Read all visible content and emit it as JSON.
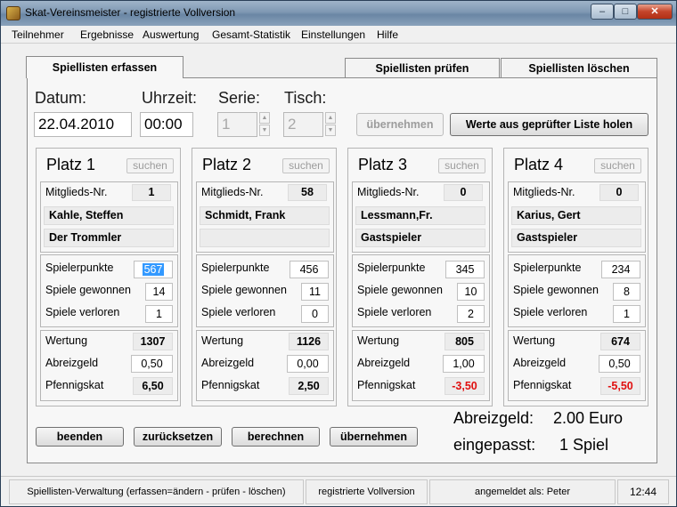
{
  "window": {
    "title": "Skat-Vereinsmeister - registrierte Vollversion"
  },
  "menu": [
    "Teilnehmer",
    "Ergebnisse",
    "Auswertung",
    "Gesamt-Statistik",
    "Einstellungen",
    "Hilfe"
  ],
  "tabs": {
    "active": "Spiellisten erfassen",
    "check": "Spiellisten prüfen",
    "delete": "Spiellisten löschen"
  },
  "header": {
    "date_label": "Datum:",
    "date_value": "22.04.2010",
    "time_label": "Uhrzeit:",
    "time_value": "00:00",
    "series_label": "Serie:",
    "series_value": "1",
    "table_label": "Tisch:",
    "table_value": "2",
    "apply_label": "übernehmen",
    "fetch_label": "Werte aus geprüfter Liste holen"
  },
  "labels": {
    "search": "suchen",
    "member_no": "Mitglieds-Nr.",
    "player_points": "Spielerpunkte",
    "games_won": "Spiele gewonnen",
    "games_lost": "Spiele verloren",
    "rating": "Wertung",
    "fee": "Abreizgeld",
    "pfennig": "Pfennigskat"
  },
  "places": [
    {
      "title": "Platz 1",
      "member_no": "1",
      "name": "Kahle, Steffen",
      "club": "Der Trommler",
      "points": "567",
      "won": "14",
      "lost": "1",
      "rating": "1307",
      "fee": "0,50",
      "pfennig": "6,50"
    },
    {
      "title": "Platz 2",
      "member_no": "58",
      "name": "Schmidt, Frank",
      "club": "",
      "points": "456",
      "won": "11",
      "lost": "0",
      "rating": "1126",
      "fee": "0,00",
      "pfennig": "2,50"
    },
    {
      "title": "Platz 3",
      "member_no": "0",
      "name": "Lessmann,Fr.",
      "club": "Gastspieler",
      "points": "345",
      "won": "10",
      "lost": "2",
      "rating": "805",
      "fee": "1,00",
      "pfennig": "-3,50"
    },
    {
      "title": "Platz 4",
      "member_no": "0",
      "name": "Karius, Gert",
      "club": "Gastspieler",
      "points": "234",
      "won": "8",
      "lost": "1",
      "rating": "674",
      "fee": "0,50",
      "pfennig": "-5,50"
    }
  ],
  "buttons": {
    "quit": "beenden",
    "reset": "zurücksetzen",
    "calculate": "berechnen",
    "apply": "übernehmen"
  },
  "summary": {
    "fee_label": "Abreizgeld:",
    "fee_value": "2.00 Euro",
    "fit_label": "eingepasst:",
    "fit_value": "1 Spiel"
  },
  "status": {
    "mode": "Spiellisten-Verwaltung (erfassen=ändern - prüfen - löschen)",
    "license": "registrierte Vollversion",
    "user": "angemeldet als: Peter",
    "clock": "12:44"
  },
  "colors": {
    "negative": "#e01010",
    "selection": "#3399ff",
    "close_button": "#c4442a"
  }
}
